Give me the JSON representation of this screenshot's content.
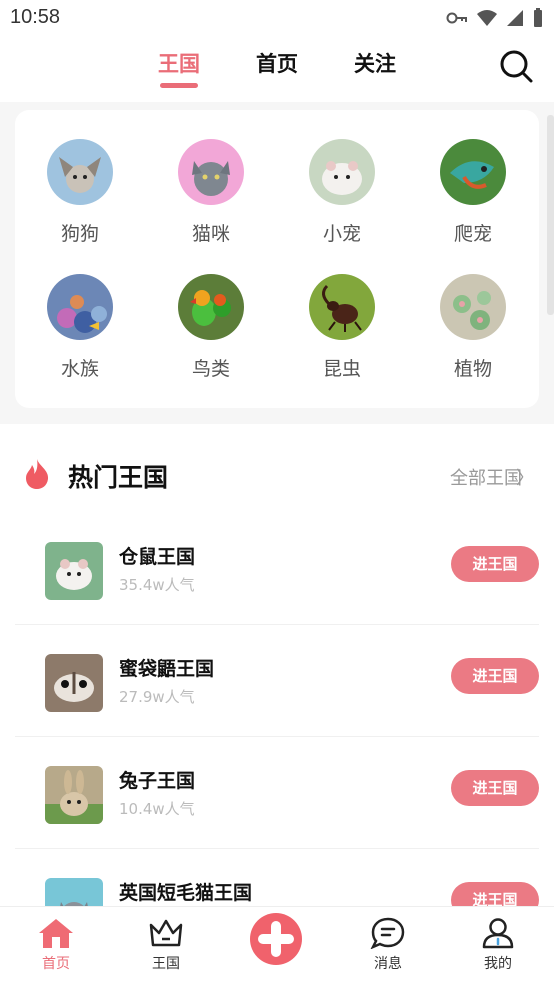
{
  "status": {
    "time": "10:58"
  },
  "top_tabs": [
    {
      "label": "王国",
      "active": true
    },
    {
      "label": "首页",
      "active": false
    },
    {
      "label": "关注",
      "active": false
    }
  ],
  "categories": [
    {
      "label": "狗狗",
      "color": "#9fc3df",
      "icon": "dog"
    },
    {
      "label": "猫咪",
      "color": "#f2a7d7",
      "icon": "cat"
    },
    {
      "label": "小宠",
      "color": "#c8d7c2",
      "icon": "hamster"
    },
    {
      "label": "爬宠",
      "color": "#4b8a3c",
      "icon": "chameleon"
    },
    {
      "label": "水族",
      "color": "#6c87b6",
      "icon": "coral"
    },
    {
      "label": "鸟类",
      "color": "#5c7d39",
      "icon": "parrot"
    },
    {
      "label": "昆虫",
      "color": "#82a73c",
      "icon": "beetle"
    },
    {
      "label": "植物",
      "color": "#cbc6b3",
      "icon": "succulent"
    }
  ],
  "hot": {
    "title": "热门王国",
    "all_label": "全部王国",
    "chevron": "〉",
    "items": [
      {
        "name": "仓鼠王国",
        "popularity": "35.4w人气",
        "button": "进王国",
        "thumb_color": "#7fb38c"
      },
      {
        "name": "蜜袋鼯王国",
        "popularity": "27.9w人气",
        "button": "进王国",
        "thumb_color": "#8d7a6a"
      },
      {
        "name": "兔子王国",
        "popularity": "10.4w人气",
        "button": "进王国",
        "thumb_color": "#b7a98a"
      },
      {
        "name": "英国短毛猫王国",
        "popularity": "",
        "button": "进王国",
        "thumb_color": "#78c6d7"
      }
    ]
  },
  "bottom_nav": [
    {
      "label": "首页",
      "active": true
    },
    {
      "label": "王国",
      "active": false
    },
    {
      "label": "",
      "active": false
    },
    {
      "label": "消息",
      "active": false
    },
    {
      "label": "我的",
      "active": false
    }
  ],
  "colors": {
    "accent": "#ea6d78",
    "button": "#eb7a84"
  }
}
